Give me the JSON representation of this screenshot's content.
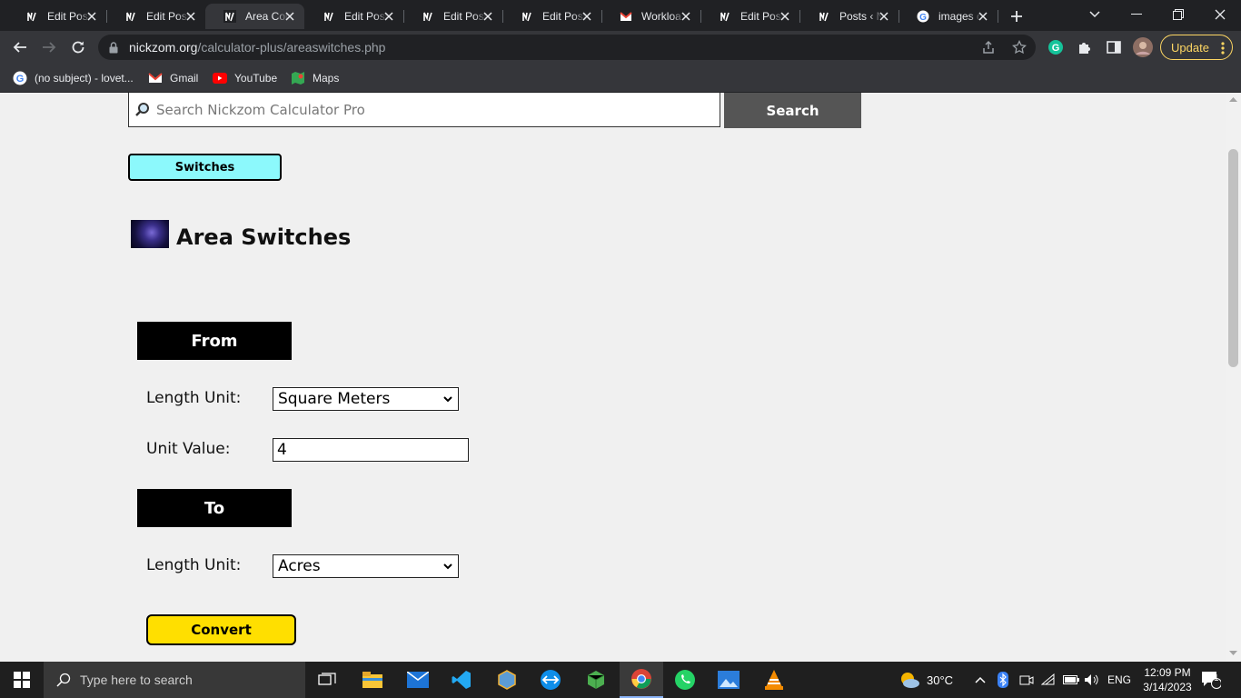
{
  "browser": {
    "tabs": [
      {
        "title": "Edit Post",
        "favicon": "nickzom-icon",
        "active": false
      },
      {
        "title": "Edit Post",
        "favicon": "nickzom-icon",
        "active": false
      },
      {
        "title": "Area Con",
        "favicon": "nickzom-icon",
        "active": true
      },
      {
        "title": "Edit Post",
        "favicon": "nickzom-icon",
        "active": false
      },
      {
        "title": "Edit Post",
        "favicon": "nickzom-icon",
        "active": false
      },
      {
        "title": "Edit Post",
        "favicon": "nickzom-icon",
        "active": false
      },
      {
        "title": "Workloa",
        "favicon": "gmail-icon",
        "active": false
      },
      {
        "title": "Edit Post",
        "favicon": "nickzom-icon",
        "active": false
      },
      {
        "title": "Posts ‹ N",
        "favicon": "nickzom-icon",
        "active": false
      },
      {
        "title": "images c",
        "favicon": "google-icon",
        "active": false
      }
    ],
    "url_host": "nickzom.org",
    "url_path": "/calculator-plus/areaswitches.php",
    "update_label": "Update",
    "bookmarks": [
      {
        "label": "(no subject) - lovet...",
        "icon": "google-icon"
      },
      {
        "label": "Gmail",
        "icon": "gmail-icon"
      },
      {
        "label": "YouTube",
        "icon": "youtube-icon"
      },
      {
        "label": "Maps",
        "icon": "maps-icon"
      }
    ],
    "accent": "#fdd663"
  },
  "page": {
    "search_placeholder": "Search Nickzom Calculator Pro",
    "search_button": "Search",
    "switches_button": "Switches",
    "title": "Area Switches",
    "from_header": "From",
    "from_unit_label": "Length Unit:",
    "from_unit_value": "Square Meters",
    "unit_value_label": "Unit Value:",
    "unit_value": "4",
    "to_header": "To",
    "to_unit_label": "Length Unit:",
    "to_unit_value": "Acres",
    "convert_button": "Convert",
    "colors": {
      "switches_bg": "#8cf9fc",
      "convert_bg": "#ffdf00",
      "header_bg": "#000000"
    }
  },
  "taskbar": {
    "search_placeholder": "Type here to search",
    "weather": "30°C",
    "language": "ENG",
    "time": "12:09 PM",
    "date": "3/14/2023",
    "notification_count": "1"
  }
}
